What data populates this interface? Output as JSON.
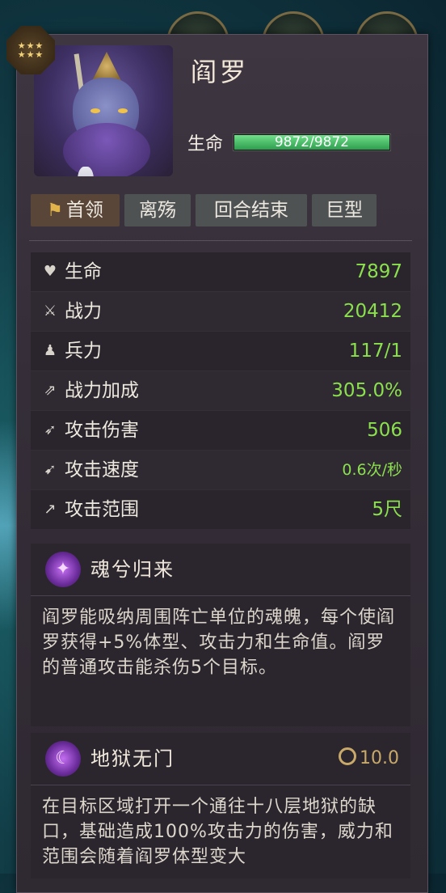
{
  "unit": {
    "name": "阎罗",
    "hp_label": "生命",
    "hp_text": "9872/9872",
    "hp_fraction": 1.0,
    "star_count": 6
  },
  "tags": [
    {
      "label": "首领",
      "icon": "flag-icon"
    },
    {
      "label": "离殇"
    },
    {
      "label": "回合结束"
    },
    {
      "label": "巨型"
    }
  ],
  "stats": [
    {
      "icon": "heart-icon",
      "label": "生命",
      "value": "7897"
    },
    {
      "icon": "swords-icon",
      "label": "战力",
      "value": "20412"
    },
    {
      "icon": "soldier-icon",
      "label": "兵力",
      "value": "117/1"
    },
    {
      "icon": "power-boost-icon",
      "label": "战力加成",
      "value": "305.0%"
    },
    {
      "icon": "attack-damage-icon",
      "label": "攻击伤害",
      "value": "506"
    },
    {
      "icon": "attack-speed-icon",
      "label": "攻击速度",
      "value": "0.6次/秒"
    },
    {
      "icon": "attack-range-icon",
      "label": "攻击范围",
      "value": "5尺"
    }
  ],
  "skills": [
    {
      "icon": "soul-skill-icon",
      "name": "魂兮归来",
      "cooldown": "",
      "description": "阎罗能吸纳周围阵亡单位的魂魄，每个使阎罗获得+5%体型、攻击力和生命值。阎罗的普通攻击能杀伤5个目标。"
    },
    {
      "icon": "hell-gate-skill-icon",
      "name": "地狱无门",
      "cooldown": "10.0",
      "description": "在目标区域打开一个通往十八层地狱的缺口，基础造成100%攻击力的伤害，威力和范围会随着阎罗体型变大"
    }
  ],
  "colors": {
    "value_green": "#8be04e",
    "hp_green": "#3fbf64",
    "panel_bg": "#3a333d",
    "cooldown_gold": "#c9a96a"
  }
}
